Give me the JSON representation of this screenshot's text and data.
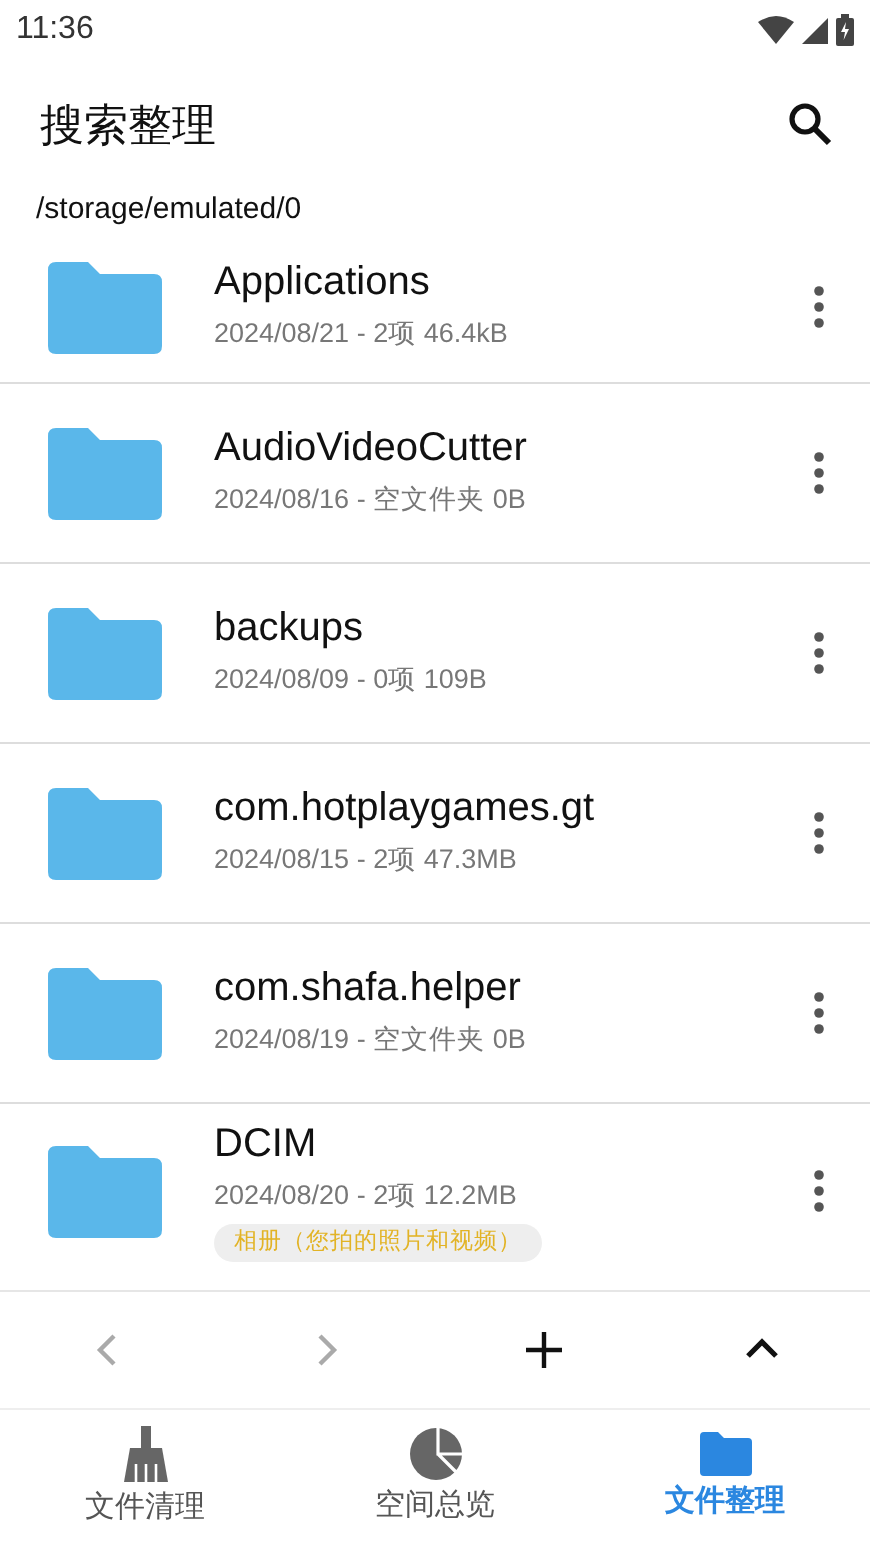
{
  "status_bar": {
    "time": "11:36"
  },
  "header": {
    "title": "搜索整理"
  },
  "path": "/storage/emulated/0",
  "folders": [
    {
      "name": "Applications",
      "info": "2024/08/21 - 2项 46.4kB"
    },
    {
      "name": "AudioVideoCutter",
      "info": "2024/08/16 - 空文件夹 0B"
    },
    {
      "name": "backups",
      "info": "2024/08/09 - 0项 109B"
    },
    {
      "name": "com.hotplaygames.gt",
      "info": "2024/08/15 - 2项 47.3MB"
    },
    {
      "name": "com.shafa.helper",
      "info": "2024/08/19 - 空文件夹 0B"
    },
    {
      "name": "DCIM",
      "info": "2024/08/20 - 2项 12.2MB",
      "tag": "相册（您拍的照片和视频）"
    }
  ],
  "toolbar": [
    {
      "kind": "back",
      "disabled": true
    },
    {
      "kind": "forward",
      "disabled": true
    },
    {
      "kind": "add",
      "disabled": false
    },
    {
      "kind": "up",
      "disabled": false
    }
  ],
  "bottom_nav": [
    {
      "kind": "broom",
      "label": "文件清理",
      "selected": false
    },
    {
      "kind": "pie",
      "label": "空间总览",
      "selected": false
    },
    {
      "kind": "folder",
      "label": "文件整理",
      "selected": true
    }
  ]
}
